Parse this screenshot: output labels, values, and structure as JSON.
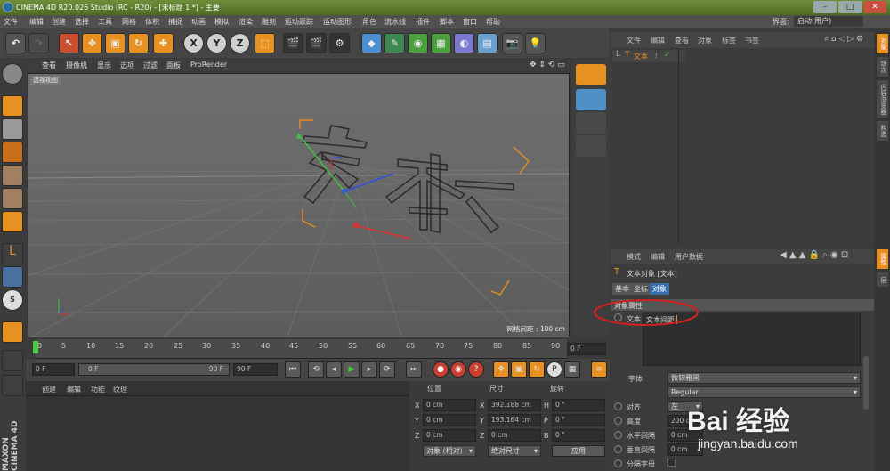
{
  "window": {
    "title": "CINEMA 4D R20.026 Studio (RC - R20) - [未标题 1 *] - 主要",
    "interface_label": "界面:",
    "interface_value": "启动(用户)"
  },
  "menu": [
    "文件",
    "编辑",
    "创建",
    "选择",
    "工具",
    "网格",
    "体积",
    "捕捉",
    "动画",
    "模拟",
    "渲染",
    "雕刻",
    "运动跟踪",
    "运动图形",
    "角色",
    "流水线",
    "插件",
    "脚本",
    "窗口",
    "帮助"
  ],
  "main_toolbar": {
    "axis_x": "X",
    "axis_y": "Y",
    "axis_z": "Z"
  },
  "viewport": {
    "menu": [
      "查看",
      "摄像机",
      "显示",
      "选项",
      "过滤",
      "面板",
      "ProRender"
    ],
    "label": "透视视图",
    "grid_spacing": "网格间距 : 100 cm",
    "text_object": "文本"
  },
  "timeline": {
    "ticks": [
      "0",
      "5",
      "10",
      "15",
      "20",
      "25",
      "30",
      "35",
      "40",
      "45",
      "50",
      "55",
      "60",
      "65",
      "70",
      "75",
      "80",
      "85",
      "90"
    ],
    "current_frame": "0 F"
  },
  "transport": {
    "start_frame": "0 F",
    "range_start": "0 F",
    "range_end": "90 F",
    "end_frame": "90 F"
  },
  "material_panel": {
    "menu": [
      "创建",
      "编辑",
      "功能",
      "纹理"
    ]
  },
  "coords_panel": {
    "headers": [
      "位置",
      "尺寸",
      "旋转"
    ],
    "rows": [
      {
        "axis": "X",
        "pos": "0 cm",
        "size": "392.188 cm",
        "rot_axis": "H",
        "rot": "0 °"
      },
      {
        "axis": "Y",
        "pos": "0 cm",
        "size": "193.164 cm",
        "rot_axis": "P",
        "rot": "0 °"
      },
      {
        "axis": "Z",
        "pos": "0 cm",
        "size": "0 cm",
        "rot_axis": "B",
        "rot": "0 °"
      }
    ],
    "mode": "对象 (相对)",
    "size_mode": "绝对尺寸",
    "apply": "应用"
  },
  "object_manager": {
    "menu": [
      "文件",
      "编辑",
      "查看",
      "对象",
      "标签",
      "书签"
    ],
    "items": [
      {
        "name": "文本"
      }
    ]
  },
  "side_tabs": [
    "对象",
    "场次",
    "内容浏览器",
    "构造",
    "属性",
    "层"
  ],
  "attributes": {
    "menu": [
      "模式",
      "编辑",
      "用户数据"
    ],
    "title": "文本对象 [文本]",
    "tabs": [
      "基本",
      "坐标",
      "对象"
    ],
    "active_tab": "对象",
    "section": "对象属性",
    "text_label": "文本",
    "text_value": "文本间距",
    "font_label": "字体",
    "font_value": "微软雅黑",
    "font_style": "Regular",
    "align_label": "对齐",
    "align_value": "左",
    "height_label": "高度",
    "height_value": "200 c",
    "hspace_label": "水平间隔",
    "hspace_value": "0 cm",
    "vspace_label": "垂直间隔",
    "vspace_value": "0 cm",
    "kerning_label": "分隔字母"
  },
  "watermark": {
    "brand": "Bai 经验",
    "url": "jingyan.baidu.com"
  },
  "colors": {
    "accent_orange": "#e89020",
    "selection_blue": "#3a6ea8",
    "annotation_red": "#d02020"
  }
}
